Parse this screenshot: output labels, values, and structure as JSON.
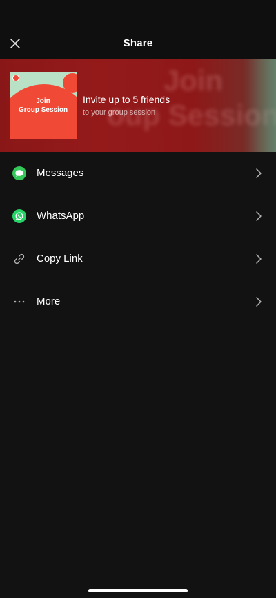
{
  "header": {
    "title": "Share",
    "close_icon": "close-icon"
  },
  "banner": {
    "artwork_line1": "Join",
    "artwork_line2": "Group Session",
    "background_text_line1": "Join",
    "background_text_line2": "oup Session",
    "invite_title": "Invite up to 5 friends",
    "invite_subtitle": "to your group session",
    "accent_color": "#f04a37",
    "artwork_bg_color": "#b8e1c6"
  },
  "menu": {
    "items": [
      {
        "label": "Messages",
        "icon": "messages-icon",
        "icon_color": "#34c759"
      },
      {
        "label": "WhatsApp",
        "icon": "whatsapp-icon",
        "icon_color": "#25d366"
      },
      {
        "label": "Copy Link",
        "icon": "link-icon"
      },
      {
        "label": "More",
        "icon": "more-icon"
      }
    ],
    "chevron_icon": "chevron-right-icon"
  }
}
